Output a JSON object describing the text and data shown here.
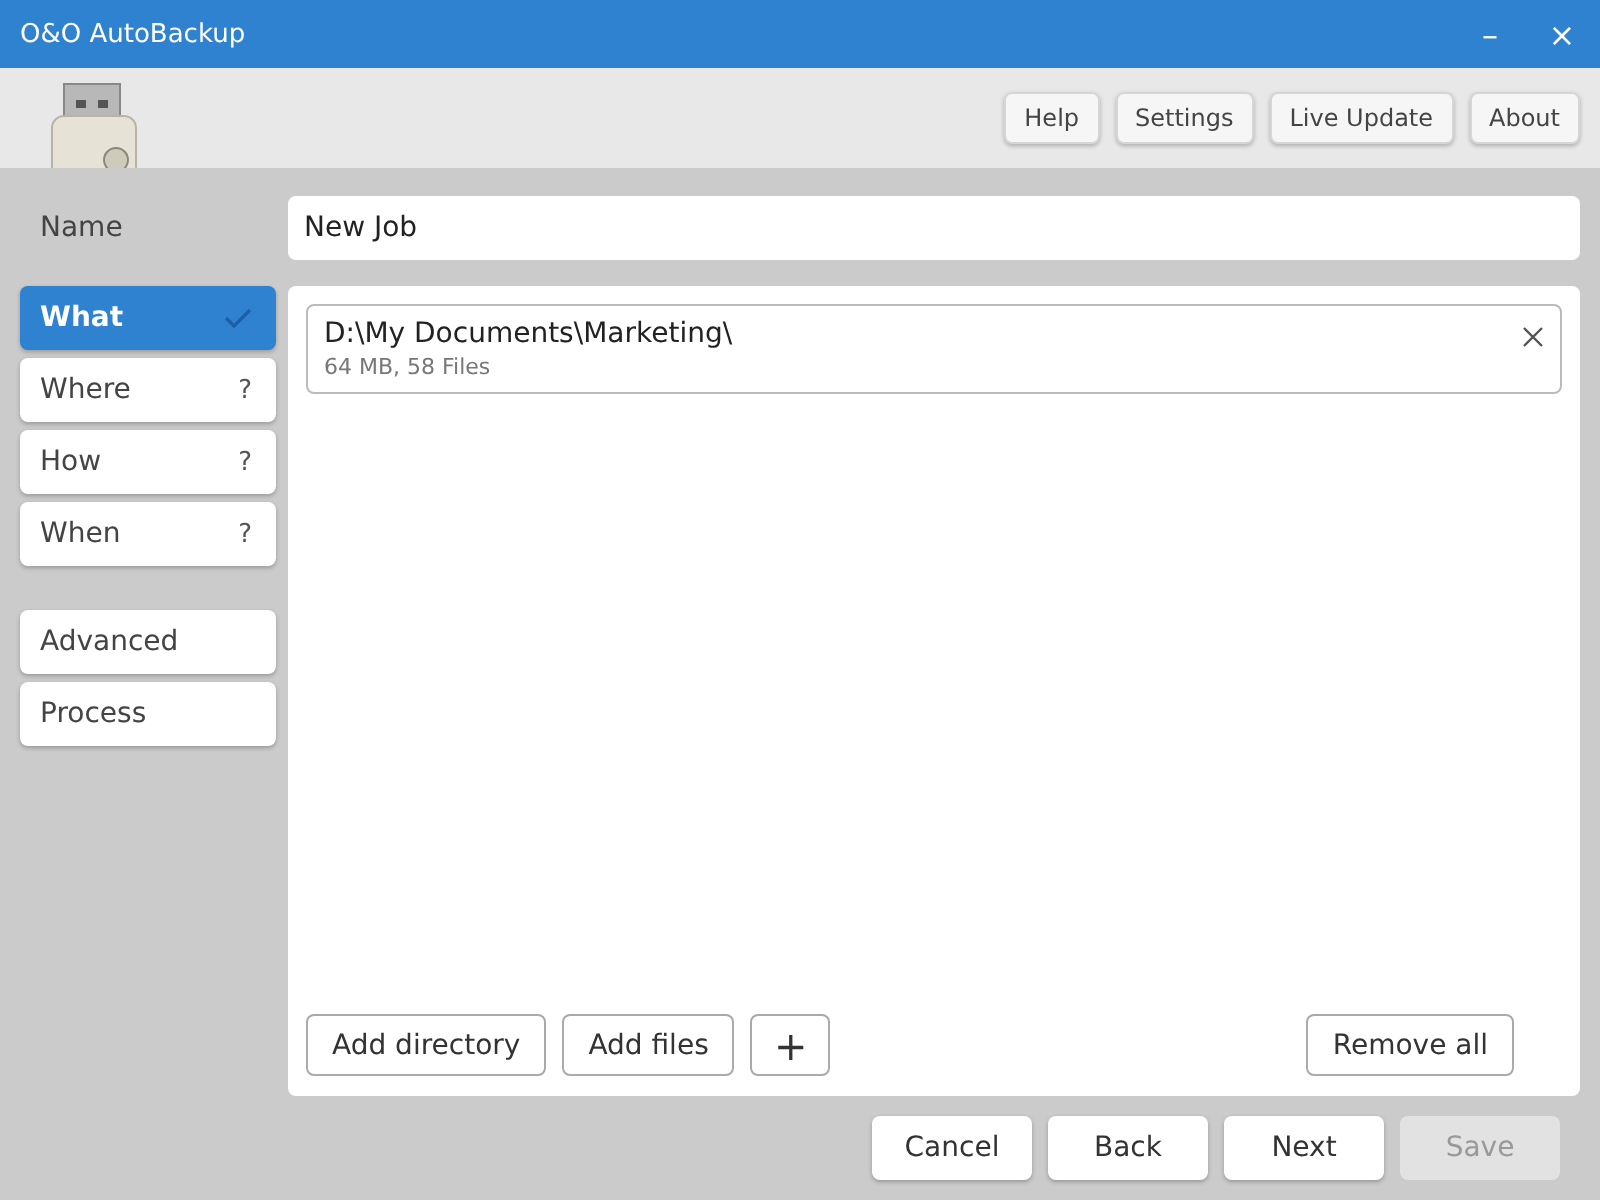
{
  "window": {
    "title": "O&O AutoBackup",
    "controls": [
      "–",
      "×"
    ]
  },
  "toolbar": {
    "buttons": [
      "Help",
      "Settings",
      "Live Update",
      "About"
    ]
  },
  "name_field": {
    "label": "Name",
    "value": "New Job"
  },
  "sidebar": {
    "steps": [
      {
        "label": "What",
        "selected": true,
        "complete": true
      },
      {
        "label": "Where",
        "selected": false,
        "complete": false,
        "badge": "?"
      },
      {
        "label": "How",
        "selected": false,
        "complete": false,
        "badge": "?"
      },
      {
        "label": "When",
        "selected": false,
        "complete": false,
        "badge": "?"
      }
    ],
    "extras": [
      {
        "label": "Advanced",
        "selected": false
      },
      {
        "label": "Process",
        "selected": false
      }
    ]
  },
  "sources": [
    {
      "path": "D:\\My Documents\\Marketing\\",
      "details": "64 MB, 58 Files"
    }
  ],
  "panel_buttons": {
    "left": [
      "Add directory",
      "Add files"
    ],
    "add_more": "+",
    "right": [
      "Remove all"
    ]
  },
  "footer_buttons": [
    {
      "label": "Cancel",
      "disabled": false
    },
    {
      "label": "Back",
      "disabled": false
    },
    {
      "label": "Next",
      "disabled": false
    },
    {
      "label": "Save",
      "disabled": true
    }
  ]
}
